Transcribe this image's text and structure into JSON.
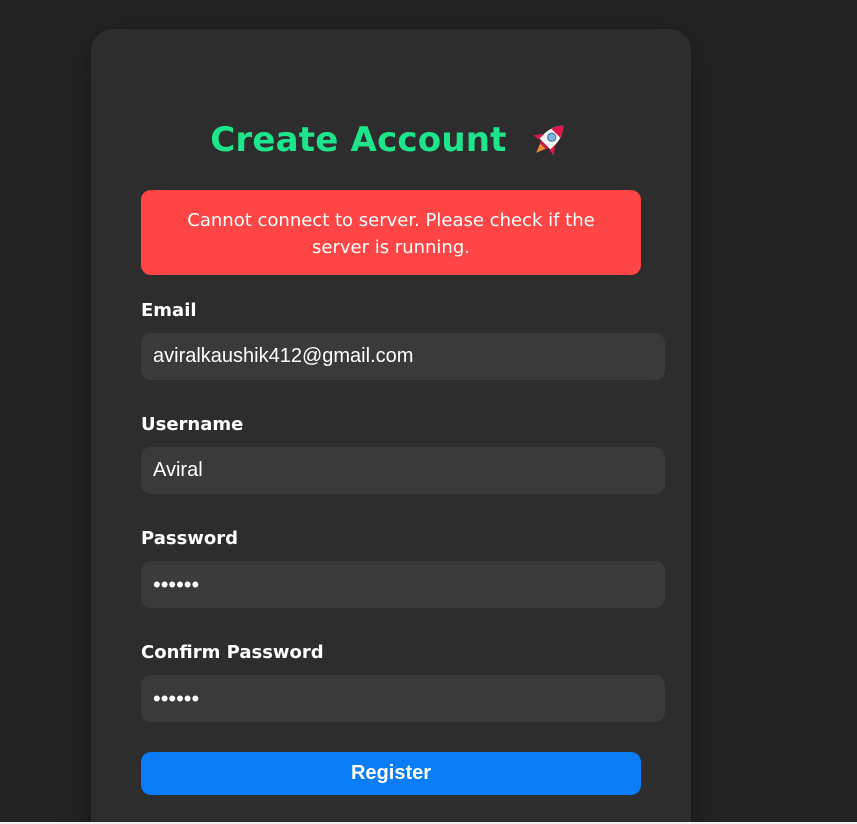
{
  "form": {
    "title": "Create Account",
    "title_icon": "rocket-icon",
    "error_message": "Cannot connect to server. Please check if the server is running.",
    "email_label": "Email",
    "email_value": "aviralkaushik412@gmail.com",
    "username_label": "Username",
    "username_value": "Aviral",
    "password_label": "Password",
    "password_value": "••••••",
    "confirm_password_label": "Confirm Password",
    "confirm_password_value": "••••••",
    "register_label": "Register"
  },
  "colors": {
    "page_background": "#232323",
    "card_background": "#2d2d2d",
    "title": "#1de58b",
    "error_background": "#ff4545",
    "input_background": "#3a3a3a",
    "button_background": "#0a7cf5"
  }
}
